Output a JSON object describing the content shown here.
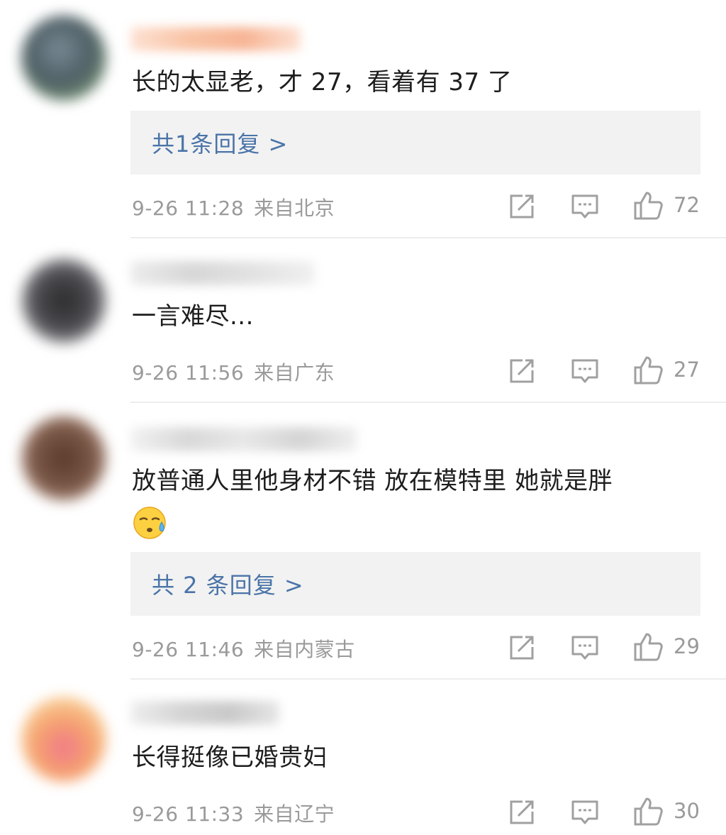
{
  "comments": [
    {
      "username": "",
      "avatar_color": "#5a6d78",
      "username_color": "#f7b494",
      "text": "长的太显老，才 27，看着有 37 了",
      "replies_label": "共1条回复 >",
      "time": "9-26 11:28",
      "location": "来自北京",
      "likes": "72"
    },
    {
      "username": "",
      "avatar_color": "#3c3c40",
      "username_color": "#d7d7d7",
      "text": "一言难尽...",
      "replies_label": "",
      "time": "9-26 11:56",
      "location": "来自广东",
      "likes": "27"
    },
    {
      "username": "",
      "avatar_color": "#6a4a3c",
      "username_color": "#dcdcdc",
      "text": "放普通人里他身材不错 放在模特里 她就是胖",
      "emoji": "sweat-smile-emoji",
      "replies_label": "共 2 条回复 >",
      "time": "9-26 11:46",
      "location": "来自内蒙古",
      "likes": "29"
    },
    {
      "username": "",
      "avatar_color": "#f0a070",
      "username_color": "#d5d5d5",
      "text": "长得挺像已婚贵妇",
      "replies_label": "",
      "time": "9-26 11:33",
      "location": "来自辽宁",
      "likes": "30"
    }
  ],
  "icons": {
    "share": "share-icon",
    "comment": "comment-icon",
    "like": "thumbs-up-icon"
  },
  "colors": {
    "link": "#4a74a8",
    "meta": "#9a9a9a",
    "reply_bg": "#f2f2f2"
  }
}
